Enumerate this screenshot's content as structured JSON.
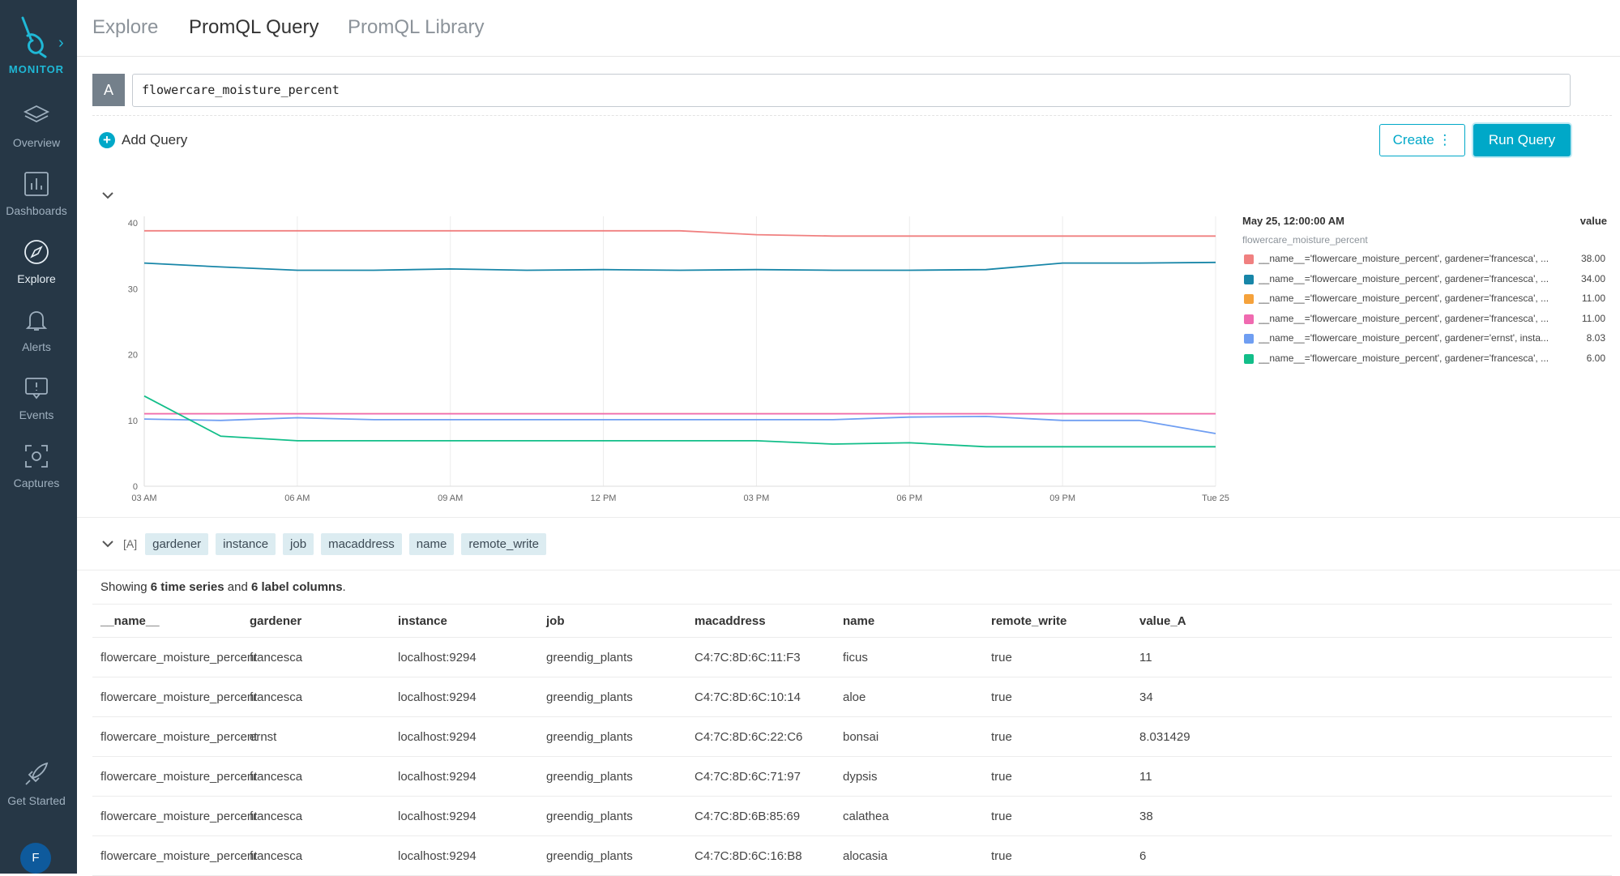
{
  "sidebar": {
    "brand": "MONITOR",
    "items": [
      {
        "label": "Overview",
        "icon": "layers-icon"
      },
      {
        "label": "Dashboards",
        "icon": "bar-chart-icon"
      },
      {
        "label": "Explore",
        "icon": "compass-icon"
      },
      {
        "label": "Alerts",
        "icon": "bell-icon"
      },
      {
        "label": "Events",
        "icon": "message-icon"
      },
      {
        "label": "Captures",
        "icon": "capture-icon"
      }
    ],
    "get_started": "Get Started",
    "avatar": "F"
  },
  "tabs": [
    "Explore",
    "PromQL Query",
    "PromQL Library"
  ],
  "query": {
    "letter": "A",
    "value": "flowercare_moisture_percent",
    "add_label": "Add Query",
    "create_label": "Create ⋮",
    "run_label": "Run Query"
  },
  "chart_data": {
    "type": "line",
    "x": [
      "03 AM",
      "04:30 AM",
      "06 AM",
      "07:30 AM",
      "09 AM",
      "10:30 AM",
      "12 PM",
      "01:30 PM",
      "03 PM",
      "04:30 PM",
      "06 PM",
      "07:30 PM",
      "09 PM",
      "10:30 PM",
      "Tue 25"
    ],
    "x_ticks": [
      "03 AM",
      "06 AM",
      "09 AM",
      "12 PM",
      "03 PM",
      "06 PM",
      "09 PM",
      "Tue 25"
    ],
    "ylim": [
      0,
      40
    ],
    "y_ticks": [
      0,
      10,
      20,
      30,
      40
    ],
    "grid": "vertical",
    "series": [
      {
        "color": "#f08080",
        "values": [
          38.8,
          38.8,
          38.8,
          38.8,
          38.8,
          38.8,
          38.8,
          38.8,
          38.2,
          38.0,
          38.0,
          38.0,
          38.0,
          38.0,
          38.0
        ]
      },
      {
        "color": "#1886a8",
        "values": [
          33.9,
          33.3,
          32.8,
          32.8,
          33.0,
          32.8,
          32.9,
          32.8,
          32.9,
          32.8,
          32.8,
          32.9,
          33.9,
          33.9,
          34.0
        ]
      },
      {
        "color": "#f5a23b",
        "values": [
          11,
          11,
          11,
          11,
          11,
          11,
          11,
          11,
          11,
          11,
          11,
          11,
          11,
          11,
          11
        ]
      },
      {
        "color": "#f06ab0",
        "values": [
          11,
          11,
          11,
          11,
          11,
          11,
          11,
          11,
          11,
          11,
          11,
          11,
          11,
          11,
          11
        ]
      },
      {
        "color": "#6f9ef2",
        "values": [
          10.2,
          10.0,
          10.4,
          10.1,
          10.1,
          10.1,
          10.1,
          10.1,
          10.1,
          10.1,
          10.5,
          10.6,
          10.0,
          10.0,
          8.0
        ]
      },
      {
        "color": "#12be89",
        "values": [
          13.7,
          7.6,
          6.9,
          6.9,
          6.9,
          6.9,
          6.9,
          6.9,
          6.9,
          6.4,
          6.6,
          6.0,
          6.0,
          6.0,
          6.0
        ]
      }
    ]
  },
  "legend": {
    "timestamp": "May 25, 12:00:00 AM",
    "value_header": "value",
    "metric": "flowercare_moisture_percent",
    "rows": [
      {
        "label": "__name__='flowercare_moisture_percent', gardener='francesca', ...",
        "value": "38.00",
        "color": "#f08080"
      },
      {
        "label": "__name__='flowercare_moisture_percent', gardener='francesca', ...",
        "value": "34.00",
        "color": "#1886a8"
      },
      {
        "label": "__name__='flowercare_moisture_percent', gardener='francesca', ...",
        "value": "11.00",
        "color": "#f5a23b"
      },
      {
        "label": "__name__='flowercare_moisture_percent', gardener='francesca', ...",
        "value": "11.00",
        "color": "#f06ab0"
      },
      {
        "label": "__name__='flowercare_moisture_percent', gardener='ernst', insta...",
        "value": "8.03",
        "color": "#6f9ef2"
      },
      {
        "label": "__name__='flowercare_moisture_percent', gardener='francesca', ...",
        "value": "6.00",
        "color": "#12be89"
      }
    ]
  },
  "labels_row": {
    "query_ref": "[A]",
    "chips": [
      "gardener",
      "instance",
      "job",
      "macaddress",
      "name",
      "remote_write"
    ]
  },
  "summary": {
    "prefix": "Showing ",
    "series": "6 time series",
    "mid": " and ",
    "columns": "6 label columns",
    "suffix": "."
  },
  "table": {
    "headers": [
      "__name__",
      "gardener",
      "instance",
      "job",
      "macaddress",
      "name",
      "remote_write",
      "value_A"
    ],
    "rows": [
      [
        "flowercare_moisture_percent",
        "francesca",
        "localhost:9294",
        "greendig_plants",
        "C4:7C:8D:6C:11:F3",
        "ficus",
        "true",
        "11"
      ],
      [
        "flowercare_moisture_percent",
        "francesca",
        "localhost:9294",
        "greendig_plants",
        "C4:7C:8D:6C:10:14",
        "aloe",
        "true",
        "34"
      ],
      [
        "flowercare_moisture_percent",
        "ernst",
        "localhost:9294",
        "greendig_plants",
        "C4:7C:8D:6C:22:C6",
        "bonsai",
        "true",
        "8.031429"
      ],
      [
        "flowercare_moisture_percent",
        "francesca",
        "localhost:9294",
        "greendig_plants",
        "C4:7C:8D:6C:71:97",
        "dypsis",
        "true",
        "11"
      ],
      [
        "flowercare_moisture_percent",
        "francesca",
        "localhost:9294",
        "greendig_plants",
        "C4:7C:8D:6B:85:69",
        "calathea",
        "true",
        "38"
      ],
      [
        "flowercare_moisture_percent",
        "francesca",
        "localhost:9294",
        "greendig_plants",
        "C4:7C:8D:6C:16:B8",
        "alocasia",
        "true",
        "6"
      ]
    ]
  }
}
